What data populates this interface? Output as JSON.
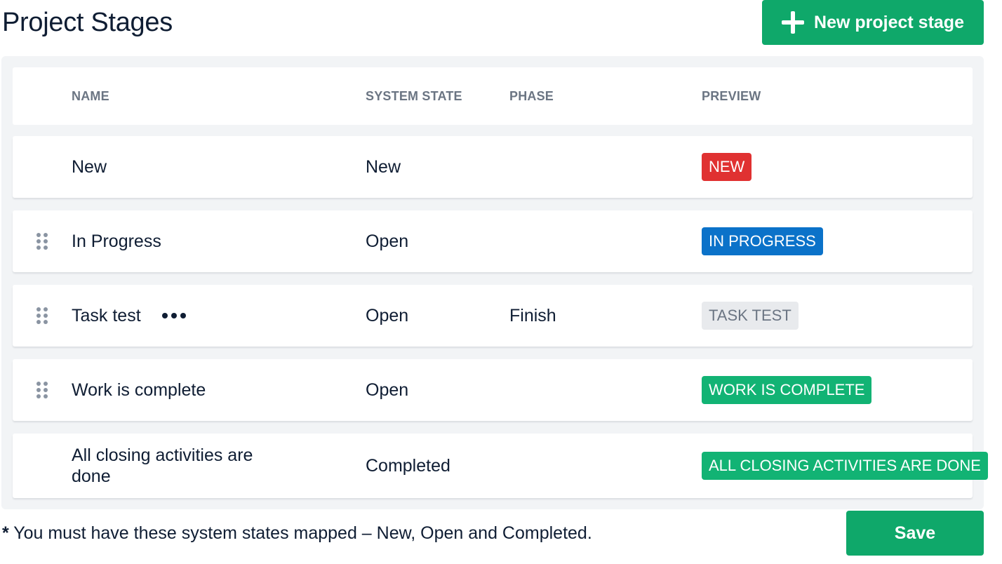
{
  "page": {
    "title": "Project Stages",
    "new_stage_button": "New project stage"
  },
  "table": {
    "headers": {
      "name": "NAME",
      "system_state": "SYSTEM STATE",
      "phase": "PHASE",
      "preview": "PREVIEW"
    },
    "rows": [
      {
        "name": "New",
        "system_state": "New",
        "phase": "",
        "preview": "NEW",
        "preview_color": "#e03131",
        "preview_text_color": "#ffffff",
        "draggable": false
      },
      {
        "name": "In Progress",
        "system_state": "Open",
        "phase": "",
        "preview": "IN PROGRESS",
        "preview_color": "#0b72c9",
        "preview_text_color": "#ffffff",
        "draggable": true
      },
      {
        "name": "Task test",
        "system_state": "Open",
        "phase": "Finish",
        "preview": "TASK TEST",
        "preview_color": "#e8eaed",
        "preview_text_color": "#6b7583",
        "draggable": true,
        "has_more_menu": true
      },
      {
        "name": "Work is complete",
        "system_state": "Open",
        "phase": "",
        "preview": "WORK IS COMPLETE",
        "preview_color": "#12b374",
        "preview_text_color": "#ffffff",
        "draggable": true
      },
      {
        "name": "All closing activities are done",
        "system_state": "Completed",
        "phase": "",
        "preview": "ALL CLOSING ACTIVITIES ARE DONE",
        "preview_color": "#12b374",
        "preview_text_color": "#ffffff",
        "draggable": false
      }
    ]
  },
  "footer": {
    "asterisk": "*",
    "note": " You must have these system states mapped – New, Open and Completed.",
    "save_button": "Save"
  },
  "colors": {
    "primary_green": "#0fa86a",
    "panel_bg": "#f2f4f6",
    "text_dark": "#0f1d33",
    "header_gray": "#6b7583"
  },
  "icons": {
    "new_button": "plus-icon",
    "row_drag": "drag-handle-icon",
    "row_menu": "more-horizontal-icon"
  }
}
